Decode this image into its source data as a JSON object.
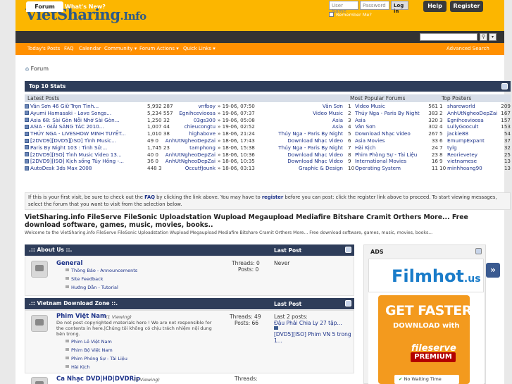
{
  "site": {
    "logo": "VietSharing",
    "logo_suffix": ".Info"
  },
  "login": {
    "username_placeholder": "User Name",
    "password_placeholder": "Password",
    "login_button": "Log in",
    "remember_label": "Remember Me?",
    "help": "Help",
    "register": "Register"
  },
  "nav": {
    "tabs": [
      "Forum",
      "What's New?"
    ]
  },
  "subnav": {
    "items": [
      "Today's Posts",
      "FAQ",
      "Calendar",
      "Community ▾",
      "Forum Actions ▾",
      "Quick Links ▾"
    ],
    "advanced_search": "Advanced Search"
  },
  "breadcrumb": "Forum",
  "stats": {
    "title": "Top 10 Stats",
    "latest_header": "Latest Posts",
    "forums_header": "Most Popular Forums",
    "posters_header": "Top Posters",
    "latest": [
      {
        "title": "Vân Sơn 46 Giữ Trọn Tình...",
        "count": "5,992 287",
        "user": "vnfboy",
        "time": "» 19-06, 07:50",
        "forum": "Vân Sơn"
      },
      {
        "title": "Ayumi Hamasaki - Love Songs...",
        "count": "5,234 557",
        "user": "Egnihcevioosa",
        "time": "» 19-06, 07:37",
        "forum": "Video Music"
      },
      {
        "title": "Asia 68: Sài Gòn Nỗi Nhớ Sài Gòn...",
        "count": "1,250 32",
        "user": "03gs300",
        "time": "» 19-06, 05:08",
        "forum": "Asia"
      },
      {
        "title": "ASIA - GIẢI SÁNG TÁC 2010...",
        "count": "1,007 44",
        "user": "chieucongtu",
        "time": "» 19-06, 02:52",
        "forum": "Asia"
      },
      {
        "title": "THÚY NGA - LIVESHOW MINH TUYẾT...",
        "count": "1,010 38",
        "user": "highabove",
        "time": "» 18-06, 21:24",
        "forum": "Thúy Nga - Paris By Night"
      },
      {
        "title": "[2DVD9][DVD5][ISO] Tình Music...",
        "count": "49 0",
        "user": "AnhUtNgheoDepZai",
        "time": "» 18-06, 17:43",
        "forum": "Download Nhạc Video"
      },
      {
        "title": "Paris By Night 103 : Tình Sử:...",
        "count": "1,745 23",
        "user": "tamphong",
        "time": "» 18-06, 15:38",
        "forum": "Thúy Nga - Paris By Night"
      },
      {
        "title": "[2DVD9][ISO] Tình Music Video 13...",
        "count": "40 0",
        "user": "AnhUtNgheoDepZai",
        "time": "» 18-06, 10:36",
        "forum": "Download Nhạc Video"
      },
      {
        "title": "[2DVD9][ISO] Kịch sống Túy Hồng -...",
        "count": "36 0",
        "user": "AnhUtNgheoDepZai",
        "time": "» 18-06, 10:35",
        "forum": "Download Nhạc Video"
      },
      {
        "title": "AutoDesk 3ds Max 2008",
        "count": "448 3",
        "user": "OccutfJounk",
        "time": "» 18-06, 03:13",
        "forum": "Graphic & Design"
      }
    ],
    "forums": [
      {
        "n": "1",
        "name": "Video Music",
        "v": "561"
      },
      {
        "n": "2",
        "name": "Thúy Nga - Paris By Night",
        "v": "383"
      },
      {
        "n": "3",
        "name": "Asia",
        "v": "320"
      },
      {
        "n": "4",
        "name": "Vân Sơn",
        "v": "302"
      },
      {
        "n": "5",
        "name": "Download Nhạc Video",
        "v": "267"
      },
      {
        "n": "6",
        "name": "Asia Movies",
        "v": "33"
      },
      {
        "n": "7",
        "name": "Hài Kịch",
        "v": "24"
      },
      {
        "n": "8",
        "name": "Phim Phòng Sự - Tài Liệu",
        "v": "23"
      },
      {
        "n": "9",
        "name": "International Movies",
        "v": "16"
      },
      {
        "n": "10",
        "name": "Operating System",
        "v": "11"
      }
    ],
    "posters": [
      {
        "n": "1",
        "name": "shareworld",
        "v": "209"
      },
      {
        "n": "2",
        "name": "AnhUtNgheoDepZai",
        "v": "167"
      },
      {
        "n": "3",
        "name": "Egnihcevioosa",
        "v": "157"
      },
      {
        "n": "4",
        "name": "LullyGoocult",
        "v": "153"
      },
      {
        "n": "5",
        "name": "jackie88",
        "v": "54"
      },
      {
        "n": "6",
        "name": "EmumpExpant",
        "v": "37"
      },
      {
        "n": "7",
        "name": "tylg",
        "v": "32"
      },
      {
        "n": "8",
        "name": "Reorievetey",
        "v": "25"
      },
      {
        "n": "9",
        "name": "vietnamese",
        "v": "13"
      },
      {
        "n": "10",
        "name": "minhhoang90",
        "v": "13"
      }
    ]
  },
  "notice": {
    "text1": "If this is your first visit, be sure to check out the ",
    "faq": "FAQ",
    "text2": " by clicking the link above. You may have to ",
    "register": "register",
    "text3": " before you can post: click the register link above to proceed. To start viewing messages, select the forum that you want to visit from the selection below."
  },
  "welcome": {
    "title": "VietSharing.info FileServe FileSonic Uploadstation Wupload Megaupload Mediafire Bitshare Cramit Orthers More... Free download software, games, music, movies, books..",
    "desc": "Welcome to the VietSharing.info FileServe FileSonic Uploadstation Wupload Megaupload Mediafire Bitshare Cramit Orthers More... Free download software, games, music, movies, books..."
  },
  "about": {
    "header": ".:: About Us ::.",
    "last_post": "Last Post",
    "forum": "General",
    "threads": "Threads: 0",
    "posts": "Posts: 0",
    "never": "Never",
    "subs": [
      "Thông Báo - Announcements",
      "Site Feedback",
      "Hướng Dẫn - Tutorial"
    ]
  },
  "vn": {
    "header": ".:: Vietnam Download Zone ::.",
    "last_post": "Last Post",
    "forum": "Phim Việt Nam",
    "viewing": "(1 Viewing)",
    "desc": "Do not post copyrighted materials here ! We are not responsible for the contents in here.|Chúng tôi không có chịu trách nhiệm nội dung bên trong.",
    "threads": "Threads: 49",
    "posts": "Posts: 66",
    "lp_label": "Last 2 posts:",
    "lp1": "Đậu Phải Chia Ly 27 tập...",
    "lp2": "[DVD5][ISO] Phim VN 5 trong 1...",
    "subs": [
      "Phim Lẻ Việt Nam",
      "Phim Bộ Việt Nam",
      "Phim Phóng Sự - Tài Liệu",
      "Hài Kịch"
    ],
    "forum2": "Ca Nhạc DVD|HD|DVDRip",
    "viewing2": "(5 Viewing)",
    "threads2": "Threads:"
  },
  "ads": {
    "header": "ADS",
    "brand": "Filmhot",
    "brand_tld": ".us",
    "get_faster": "GET FASTER",
    "download_with": "DOWNLOAD with",
    "fileserve": "fileserve",
    "premium": "PREMIUM",
    "no_wait": "No Waiting Time"
  }
}
